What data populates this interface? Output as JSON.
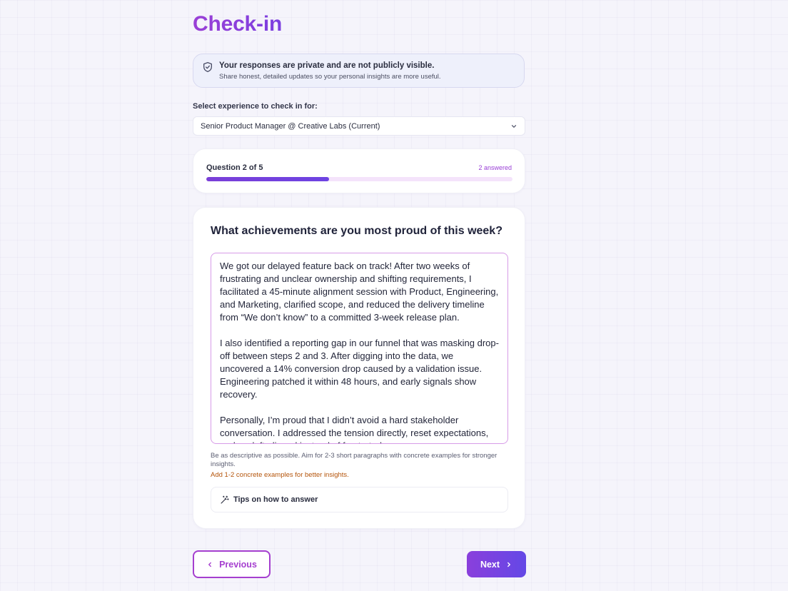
{
  "page": {
    "title": "Check-in"
  },
  "privacy": {
    "icon": "shield-check-icon",
    "title": "Your responses are private and are not publicly visible.",
    "subtitle": "Share honest, detailed updates so your personal insights are more useful."
  },
  "experience": {
    "label": "Select experience to check in for:",
    "selected": "Senior Product Manager @ Creative Labs (Current)"
  },
  "progress": {
    "label": "Question 2 of 5",
    "answered": "2 answered",
    "current": 2,
    "total": 5,
    "fraction": 0.4
  },
  "question": {
    "text": "What achievements are you most proud of this week?",
    "answer_paragraphs": [
      "We got our delayed feature back on track! After two weeks of frustrating and unclear ownership and shifting requirements, I facilitated a 45-minute alignment session with Product, Engineering, and Marketing, clarified scope, and reduced the delivery timeline from “We don’t know” to a committed 3-week release plan.",
      "I also identified a reporting gap in our funnel that was masking drop-off between steps 2 and 3. After digging into the data, we uncovered a 14% conversion drop caused by a validation issue. Engineering patched it within 48 hours, and early signals show recovery.",
      "Personally, I’m proud that I didn’t avoid a hard stakeholder conversation. I addressed the tension directly, reset expectations, and we left aligned instead of frustrated."
    ],
    "helper": "Be as descriptive as possible. Aim for 2-3 short paragraphs with concrete examples for stronger insights.",
    "warning": "Add 1-2 concrete examples for better insights.",
    "tips_label": "Tips on how to answer",
    "tips_icon": "magic-wand-icon"
  },
  "nav": {
    "previous_label": "Previous",
    "next_label": "Next"
  },
  "colors": {
    "accent": "#9a3fd6",
    "next_gradient_start": "#8a3fdc",
    "next_gradient_end": "#6448e6",
    "warning": "#b45309"
  }
}
